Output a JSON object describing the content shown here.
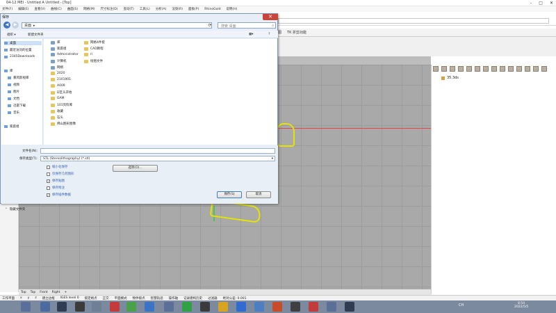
{
  "app": {
    "title": "04-12 MEI - Untitled A Untitled - [Top]",
    "menu": [
      "文件(F)",
      "编辑(E)",
      "查看(V)",
      "曲线(C)",
      "曲面(S)",
      "网格(M)",
      "尺寸标注(D)",
      "变动(T)",
      "工具(L)",
      "分析(A)",
      "渲染(R)",
      "面板(P)",
      "RhinoGold",
      "说明(H)"
    ],
    "tabs": [
      "图",
      "TK 折剪功能"
    ],
    "viewport_tabs": [
      "Top",
      "Top",
      "Front",
      "Right",
      "+"
    ],
    "status": [
      "工作平面",
      "x",
      "y",
      "z",
      "建立边框",
      "IGES level 0",
      "锁定格点",
      "正交",
      "平面模式",
      "物件锁点",
      "智慧轨迹",
      "操作轴",
      "记录建构历史",
      "过滤器",
      "绝对公差: 0.001"
    ],
    "layer_item": "35.3ds"
  },
  "taskbar": {
    "tray_label": "CH",
    "clock_time": "8:54",
    "clock_date": "2022/5/5"
  },
  "dialog": {
    "title": "保存",
    "address": [
      "桌面",
      "▸"
    ],
    "search_placeholder": "搜索 桌面",
    "organize": "组织 ▾",
    "new_folder": "新建文件夹",
    "nav": [
      "桌面",
      "最近访问的位置",
      "2345Downloads",
      "库",
      "暴风影视库",
      "视频",
      "图片",
      "文档",
      "迅雷下载",
      "音乐",
      "家庭组"
    ],
    "files_col1": [
      "库",
      "家庭组",
      "Administrator",
      "计算机",
      "网络",
      "2020",
      "2101901",
      "A009",
      "D区头开始",
      "GAM",
      "101资料库",
      "收藏",
      "石头",
      "佛山图形图像"
    ],
    "files_col2": [
      "网格4件套",
      "CAD教程",
      "ri",
      "绘图文件"
    ],
    "filename_label": "文件名(N):",
    "filename_value": "",
    "filetype_label": "保存类型(T):",
    "filetype_value": "STL (Stereolithography) (*.stl)",
    "options_button": "选项(O)...",
    "checkboxes": [
      {
        "label": "缩小化保存",
        "checked": false
      },
      {
        "label": "仅保存几何图形",
        "checked": false
      },
      {
        "label": "保存贴图",
        "checked": true
      },
      {
        "label": "保存附注",
        "checked": false
      },
      {
        "label": "保存插件数据",
        "checked": true
      }
    ],
    "save_button": "保存(S)",
    "cancel_button": "取消",
    "hide_folders": "隐藏文件夹"
  }
}
